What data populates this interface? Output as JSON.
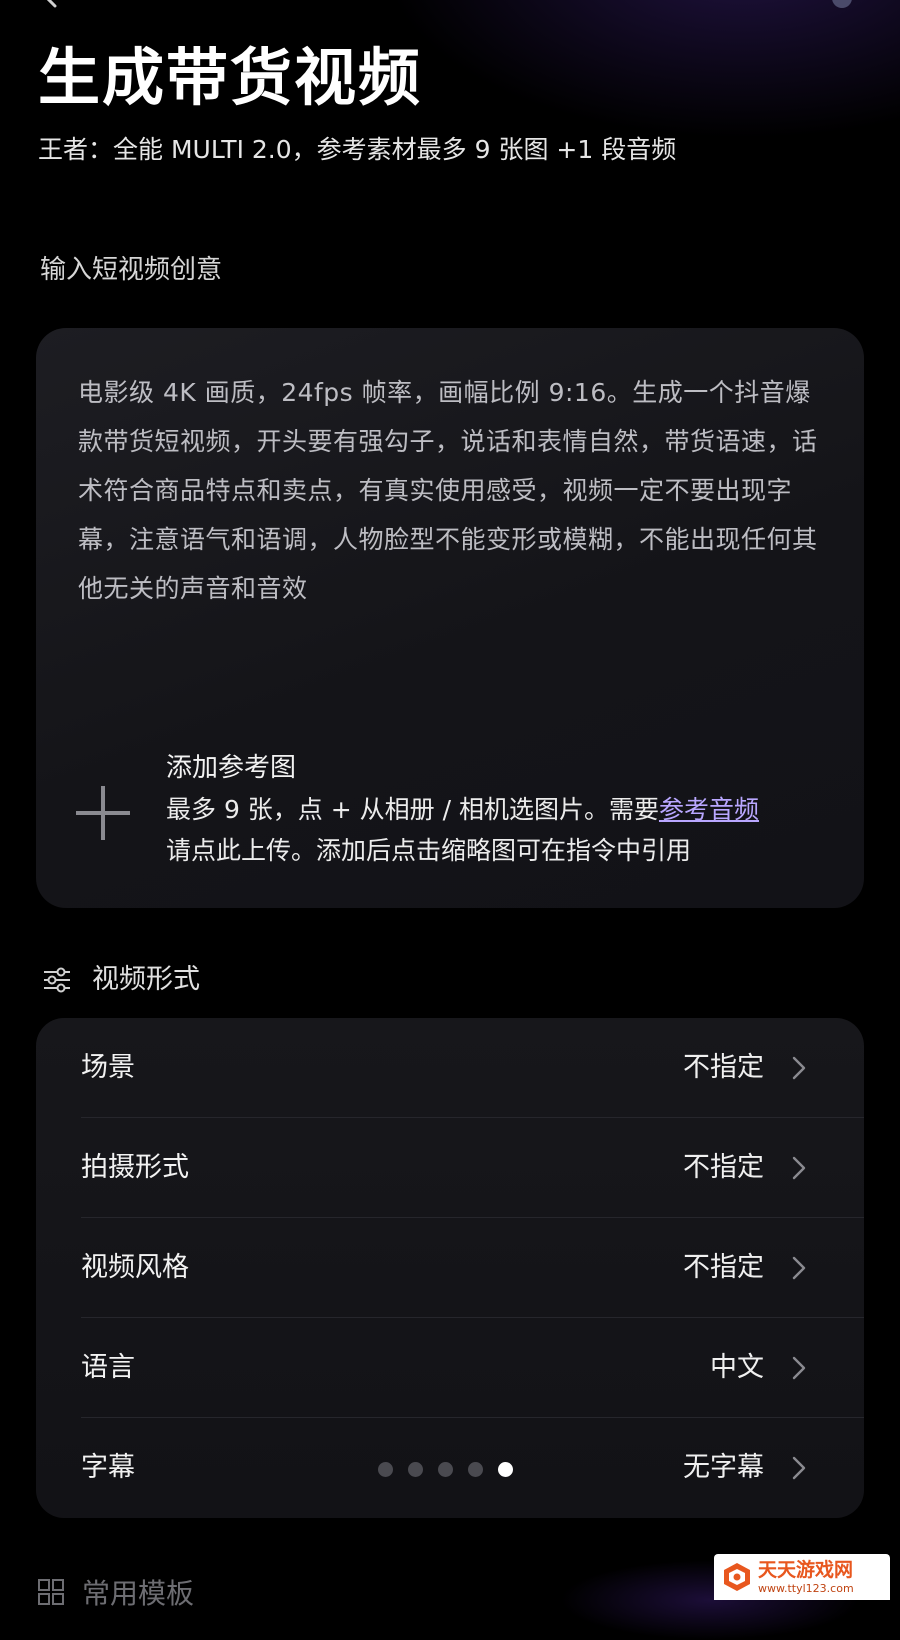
{
  "header": {
    "title": "生成带货视频",
    "subtitle": "王者：全能 MULTI 2.0，参考素材最多 9 张图 +1 段音频"
  },
  "prompt_section": {
    "label": "输入短视频创意",
    "text": "电影级 4K 画质，24fps 帧率，画幅比例 9:16。生成一个抖音爆款带货短视频，开头要有强勾子，说话和表情自然，带货语速，话术符合商品特点和卖点，有真实使用感受，视频一定不要出现字幕，注意语气和语调，人物脸型不能变形或模糊，不能出现任何其他无关的声音和音效",
    "add_reference": {
      "title": "添加参考图",
      "desc_prefix": "最多 9 张，点 + 从相册 / 相机选图片。需要",
      "audio_link": "参考音频",
      "desc_suffix": "请点此上传。添加后点击缩略图可在指令中引用"
    }
  },
  "video_form": {
    "header": "视频形式",
    "rows": [
      {
        "label": "场景",
        "value": "不指定"
      },
      {
        "label": "拍摄形式",
        "value": "不指定"
      },
      {
        "label": "视频风格",
        "value": "不指定"
      },
      {
        "label": "语言",
        "value": "中文"
      },
      {
        "label": "字幕",
        "value": "无字幕"
      }
    ],
    "dots": {
      "count": 5,
      "active_index": 4
    }
  },
  "bottom": {
    "partial_label": "常用模板"
  },
  "watermark": {
    "name": "天天游戏网",
    "url": "www.ttyl123.com"
  },
  "colors": {
    "background": "#000000",
    "card": "#17171b",
    "link": "#b9a7ff",
    "watermark": "#e8571e"
  }
}
